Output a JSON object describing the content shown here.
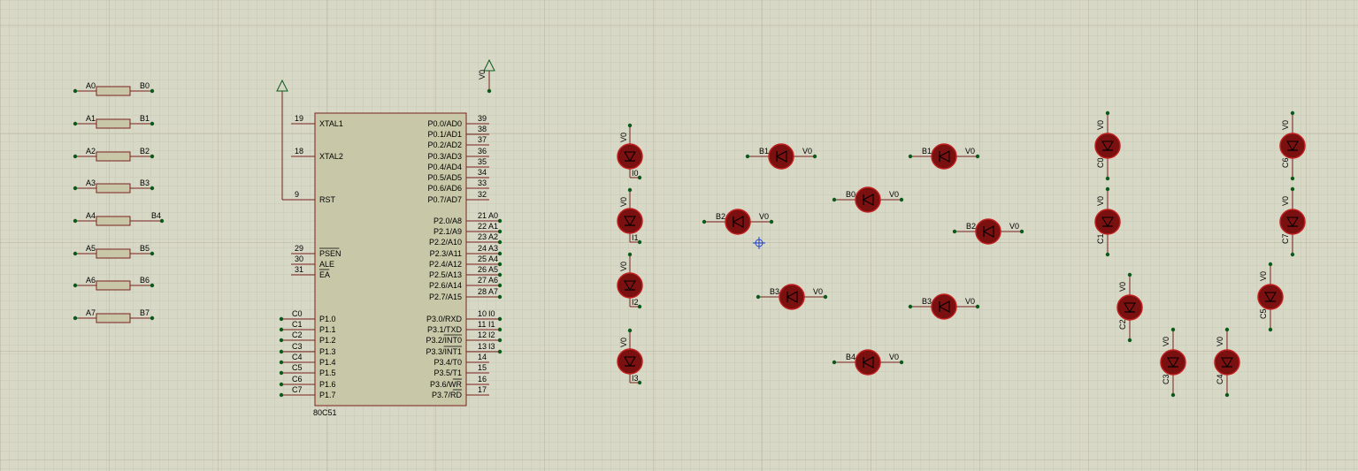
{
  "resistors": [
    {
      "a": "A0",
      "b": "B0"
    },
    {
      "a": "A1",
      "b": "B1"
    },
    {
      "a": "A2",
      "b": "B2"
    },
    {
      "a": "A3",
      "b": "B3"
    },
    {
      "a": "A4",
      "b": "B4"
    },
    {
      "a": "A5",
      "b": "B5"
    },
    {
      "a": "A6",
      "b": "B6"
    },
    {
      "a": "A7",
      "b": "B7"
    }
  ],
  "mcu": {
    "part": "80C51",
    "left_pins": [
      {
        "num": "19",
        "name": "XTAL1"
      },
      {
        "num": "18",
        "name": "XTAL2"
      },
      {
        "num": "9",
        "name": "RST"
      },
      {
        "num": "29",
        "name": "PSEN",
        "overbar": true
      },
      {
        "num": "30",
        "name": "ALE"
      },
      {
        "num": "31",
        "name": "EA",
        "overbar": true
      },
      {
        "num": "",
        "name": "P1.0",
        "net": "C0"
      },
      {
        "num": "",
        "name": "P1.1",
        "net": "C1"
      },
      {
        "num": "",
        "name": "P1.2",
        "net": "C2"
      },
      {
        "num": "",
        "name": "P1.3",
        "net": "C3"
      },
      {
        "num": "",
        "name": "P1.4",
        "net": "C4"
      },
      {
        "num": "",
        "name": "P1.5",
        "net": "C5"
      },
      {
        "num": "",
        "name": "P1.6",
        "net": "C6"
      },
      {
        "num": "",
        "name": "P1.7",
        "net": "C7"
      }
    ],
    "right_pins": [
      {
        "num": "39",
        "name": "P0.0/AD0"
      },
      {
        "num": "38",
        "name": "P0.1/AD1"
      },
      {
        "num": "37",
        "name": "P0.2/AD2"
      },
      {
        "num": "36",
        "name": "P0.3/AD3"
      },
      {
        "num": "35",
        "name": "P0.4/AD4"
      },
      {
        "num": "34",
        "name": "P0.5/AD5"
      },
      {
        "num": "33",
        "name": "P0.6/AD6"
      },
      {
        "num": "32",
        "name": "P0.7/AD7"
      },
      {
        "num": "21",
        "name": "P2.0/A8",
        "net": "A0"
      },
      {
        "num": "22",
        "name": "P2.1/A9",
        "net": "A1"
      },
      {
        "num": "23",
        "name": "P2.2/A10",
        "net": "A2"
      },
      {
        "num": "24",
        "name": "P2.3/A11",
        "net": "A3"
      },
      {
        "num": "25",
        "name": "P2.4/A12",
        "net": "A4"
      },
      {
        "num": "26",
        "name": "P2.5/A13",
        "net": "A5"
      },
      {
        "num": "27",
        "name": "P2.6/A14",
        "net": "A6"
      },
      {
        "num": "28",
        "name": "P2.7/A15",
        "net": "A7"
      },
      {
        "num": "10",
        "name": "P3.0/RXD",
        "net": "I0"
      },
      {
        "num": "11",
        "name": "P3.1/TXD",
        "net": "I1"
      },
      {
        "num": "12",
        "name": "P3.2/INT0",
        "net": "I2",
        "over_from": 5
      },
      {
        "num": "13",
        "name": "P3.3/INT1",
        "net": "I3",
        "over_from": 5
      },
      {
        "num": "14",
        "name": "P3.4/T0"
      },
      {
        "num": "15",
        "name": "P3.5/T1"
      },
      {
        "num": "16",
        "name": "P3.6/WR",
        "over_from": 5
      },
      {
        "num": "17",
        "name": "P3.7/RD",
        "over_from": 5
      }
    ]
  },
  "power_label": "V0",
  "leds_vertical": [
    {
      "top": "V0",
      "bottom": "I0"
    },
    {
      "top": "V0",
      "bottom": "I1"
    },
    {
      "top": "V0",
      "bottom": "I2"
    },
    {
      "top": "V0",
      "bottom": "I3"
    }
  ],
  "leds_horizontal": [
    {
      "left": "B1",
      "right": "V0"
    },
    {
      "left": "B1",
      "right": "V0"
    },
    {
      "left": "B0",
      "right": "V0"
    },
    {
      "left": "B2",
      "right": "V0"
    },
    {
      "left": "B2",
      "right": "V0"
    },
    {
      "left": "B3",
      "right": "V0"
    },
    {
      "left": "B3",
      "right": "V0"
    },
    {
      "left": "B4",
      "right": "V0"
    }
  ],
  "leds_c": [
    {
      "top": "V0",
      "side": "C0"
    },
    {
      "top": "V0",
      "side": "C1"
    },
    {
      "top": "V0",
      "side": "C2"
    },
    {
      "top": "V0",
      "side": "C3"
    },
    {
      "top": "V0",
      "side": "C4"
    },
    {
      "top": "V0",
      "side": "C5"
    },
    {
      "top": "V0",
      "side": "C6"
    },
    {
      "top": "V0",
      "side": "C7"
    }
  ],
  "colors": {
    "background": "#d8d8c6",
    "grid_minor": "#c9c9b7",
    "grid_major": "#b9b9a6",
    "wire": "#7a1f1f",
    "chip_body": "#c8c8a8",
    "led_fill": "#7a1010",
    "led_edge": "#c02020",
    "dot": "#0a5a1a",
    "cursor": "#2244cc"
  }
}
